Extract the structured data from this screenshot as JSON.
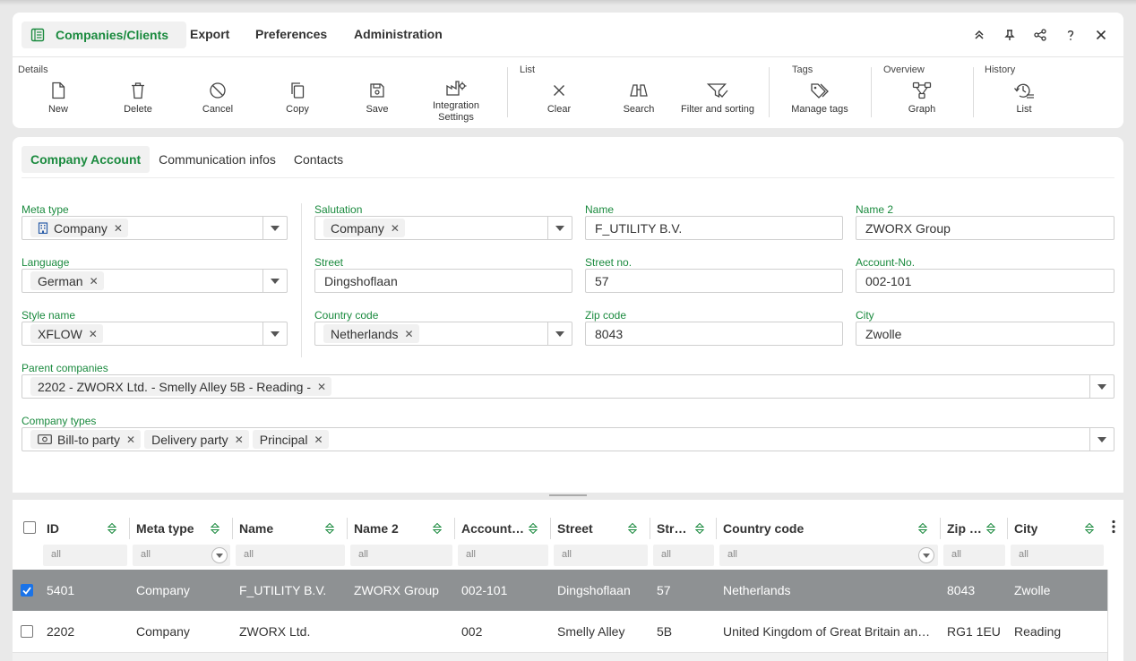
{
  "app": {
    "title": "Companies/Clients",
    "menu": [
      "Export",
      "Preferences",
      "Administration"
    ]
  },
  "window_buttons": [
    "collapse-up-icon",
    "pin-icon",
    "share-icon",
    "help-icon",
    "close-icon"
  ],
  "toolbar": {
    "groups": {
      "details": "Details",
      "list": "List",
      "tags": "Tags",
      "overview": "Overview",
      "history": "History"
    },
    "new": "New",
    "delete": "Delete",
    "cancel": "Cancel",
    "copy": "Copy",
    "save": "Save",
    "integration_settings": "Integration Settings",
    "clear": "Clear",
    "search": "Search",
    "filter_sorting": "Filter and sorting",
    "manage_tags": "Manage tags",
    "graph": "Graph",
    "history_list": "List"
  },
  "tabs": [
    "Company Account",
    "Communication infos",
    "Contacts"
  ],
  "form": {
    "meta_type": {
      "label": "Meta type",
      "chip": "Company"
    },
    "salutation": {
      "label": "Salutation",
      "chip": "Company"
    },
    "name": {
      "label": "Name",
      "value": "F_UTILITY B.V."
    },
    "name2": {
      "label": "Name 2",
      "value": "ZWORX Group"
    },
    "language": {
      "label": "Language",
      "chip": "German"
    },
    "street": {
      "label": "Street",
      "value": "Dingshoflaan"
    },
    "street_no": {
      "label": "Street no.",
      "value": "57"
    },
    "account_no": {
      "label": "Account-No.",
      "value": "002-101"
    },
    "style_name": {
      "label": "Style name",
      "chip": "XFLOW"
    },
    "country_code": {
      "label": "Country code",
      "chip": "Netherlands"
    },
    "zip": {
      "label": "Zip code",
      "value": "8043"
    },
    "city": {
      "label": "City",
      "value": "Zwolle"
    },
    "parent_companies": {
      "label": "Parent companies",
      "chip": "2202 - ZWORX Ltd. - Smelly Alley 5B - Reading -"
    },
    "company_types": {
      "label": "Company types",
      "chips": [
        "Bill-to party",
        "Delivery party",
        "Principal"
      ]
    },
    "remove_glyph": "✕"
  },
  "grid": {
    "columns": [
      "ID",
      "Meta type",
      "Name",
      "Name 2",
      "Account…",
      "Street",
      "Str…",
      "Country code",
      "Zip …",
      "City"
    ],
    "filter_placeholder": "all",
    "rows": [
      {
        "selected": true,
        "cells": [
          "5401",
          "Company",
          "F_UTILITY B.V.",
          "ZWORX Group",
          "002-101",
          "Dingshoflaan",
          "57",
          "Netherlands",
          "8043",
          "Zwolle"
        ]
      },
      {
        "selected": false,
        "cells": [
          "2202",
          "Company",
          "ZWORX Ltd.",
          "",
          "002",
          "Smelly Alley",
          "5B",
          "United Kingdom of Great Britain an…",
          "RG1 1EU",
          "Reading"
        ]
      }
    ]
  },
  "colors": {
    "accent": "#1a8a3e",
    "selected_row": "#8e9193",
    "checkbox": "#1a73e8"
  }
}
